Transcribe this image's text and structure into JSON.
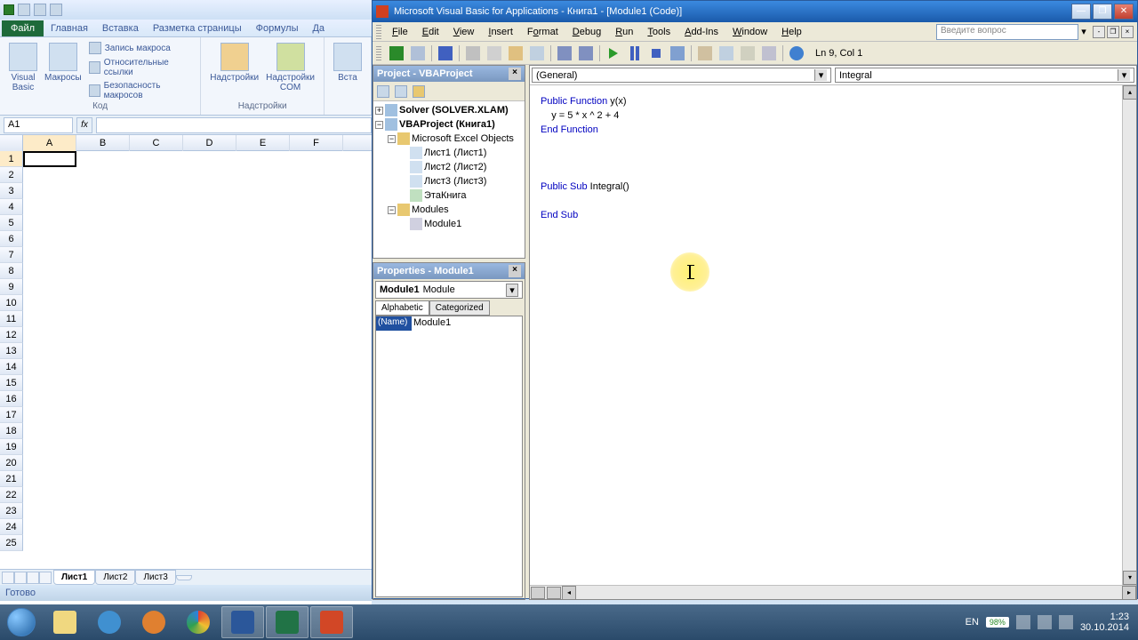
{
  "excel": {
    "tabs": {
      "file": "Файл",
      "home": "Главная",
      "insert": "Вставка",
      "pagelayout": "Разметка страницы",
      "formulas": "Формулы",
      "data": "Да"
    },
    "ribbon": {
      "vb": "Visual\nBasic",
      "macros": "Макросы",
      "record": "Запись макроса",
      "relative": "Относительные ссылки",
      "security": "Безопасность макросов",
      "code_group": "Код",
      "addins": "Надстройки",
      "comaddins": "Надстройки\nCOM",
      "addins_group": "Надстройки",
      "insert": "Вста"
    },
    "namebox": "A1",
    "fx": "fx",
    "columns": [
      "A",
      "B",
      "C",
      "D",
      "E",
      "F"
    ],
    "rows": [
      "1",
      "2",
      "3",
      "4",
      "5",
      "6",
      "7",
      "8",
      "9",
      "10",
      "11",
      "12",
      "13",
      "14",
      "15",
      "16",
      "17",
      "18",
      "19",
      "20",
      "21",
      "22",
      "23",
      "24",
      "25"
    ],
    "sheets": {
      "s1": "Лист1",
      "s2": "Лист2",
      "s3": "Лист3"
    },
    "status": "Готово"
  },
  "vba": {
    "title": "Microsoft Visual Basic for Applications - Книга1 - [Module1 (Code)]",
    "menu": {
      "file": "File",
      "edit": "Edit",
      "view": "View",
      "insert": "Insert",
      "format": "Format",
      "debug": "Debug",
      "run": "Run",
      "tools": "Tools",
      "addins": "Add-Ins",
      "window": "Window",
      "help": "Help"
    },
    "question_placeholder": "Введите вопрос",
    "cursor_pos": "Ln 9, Col 1",
    "project": {
      "header": "Project - VBAProject",
      "solver": "Solver (SOLVER.XLAM)",
      "vbaproject": "VBAProject (Книга1)",
      "excel_objects": "Microsoft Excel Objects",
      "sheet1": "Лист1 (Лист1)",
      "sheet2": "Лист2 (Лист2)",
      "sheet3": "Лист3 (Лист3)",
      "thisworkbook": "ЭтаКнига",
      "modules": "Modules",
      "module1": "Module1"
    },
    "properties": {
      "header": "Properties - Module1",
      "object": "Module1",
      "object_type": "Module",
      "tab_alpha": "Alphabetic",
      "tab_cat": "Categorized",
      "name_key": "(Name)",
      "name_val": "Module1"
    },
    "code": {
      "dropdown_left": "(General)",
      "dropdown_right": "Integral",
      "line1a": "Public Function ",
      "line1b": "y(x)",
      "line2": "    y = 5 * x ^ 2 + 4",
      "line3": "End Function",
      "line4a": "Public Sub ",
      "line4b": "Integral()",
      "line5": "End Sub"
    }
  },
  "taskbar": {
    "lang": "EN",
    "battery": "98%",
    "time": "1:23",
    "date": "30.10.2014"
  }
}
